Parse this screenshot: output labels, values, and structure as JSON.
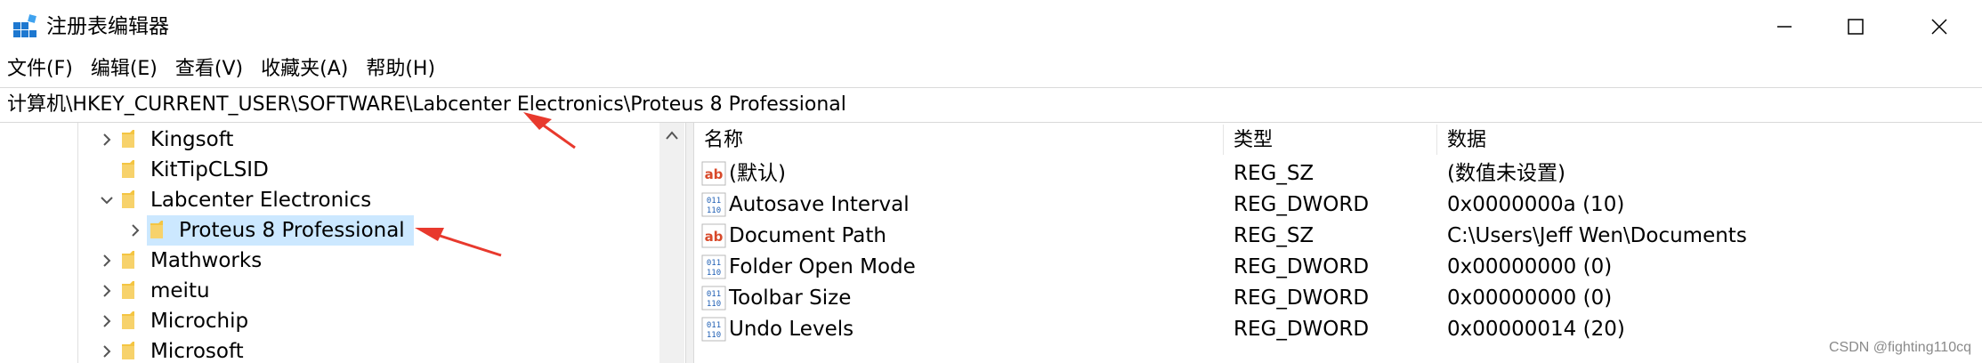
{
  "window": {
    "title": "注册表编辑器",
    "controls": [
      "minimize-icon",
      "maximize-icon",
      "close-icon"
    ]
  },
  "menu": [
    "文件(F)",
    "编辑(E)",
    "查看(V)",
    "收藏夹(A)",
    "帮助(H)"
  ],
  "address": "计算机\\HKEY_CURRENT_USER\\SOFTWARE\\Labcenter Electronics\\Proteus 8 Professional",
  "tree": [
    {
      "label": "Kingsoft",
      "expander": "collapsed"
    },
    {
      "label": "KitTipCLSID",
      "expander": "none"
    },
    {
      "label": "Labcenter Electronics",
      "expander": "expanded"
    },
    {
      "label": "Proteus 8 Professional",
      "expander": "collapsed",
      "selected": true
    },
    {
      "label": "Mathworks",
      "expander": "collapsed"
    },
    {
      "label": "meitu",
      "expander": "collapsed"
    },
    {
      "label": "Microchip",
      "expander": "collapsed"
    },
    {
      "label": "Microsoft",
      "expander": "collapsed"
    }
  ],
  "columns": {
    "name": "名称",
    "type": "类型",
    "data": "数据"
  },
  "values": [
    {
      "icon": "string-value-icon",
      "name": "(默认)",
      "type": "REG_SZ",
      "data": "(数值未设置)"
    },
    {
      "icon": "binary-value-icon",
      "name": "Autosave Interval",
      "type": "REG_DWORD",
      "data": "0x0000000a (10)"
    },
    {
      "icon": "string-value-icon",
      "name": "Document Path",
      "type": "REG_SZ",
      "data": "C:\\Users\\Jeff Wen\\Documents"
    },
    {
      "icon": "binary-value-icon",
      "name": "Folder Open Mode",
      "type": "REG_DWORD",
      "data": "0x00000000 (0)"
    },
    {
      "icon": "binary-value-icon",
      "name": "Toolbar Size",
      "type": "REG_DWORD",
      "data": "0x00000000 (0)"
    },
    {
      "icon": "binary-value-icon",
      "name": "Undo Levels",
      "type": "REG_DWORD",
      "data": "0x00000014 (20)"
    }
  ],
  "watermark": "CSDN @fighting110cq",
  "colors": {
    "selection": "#cce8ff",
    "folder": "#f4c542",
    "annotation_arrow": "#e8392d",
    "string_icon": "#d84a2b",
    "binary_icon": "#1f5fb4"
  }
}
